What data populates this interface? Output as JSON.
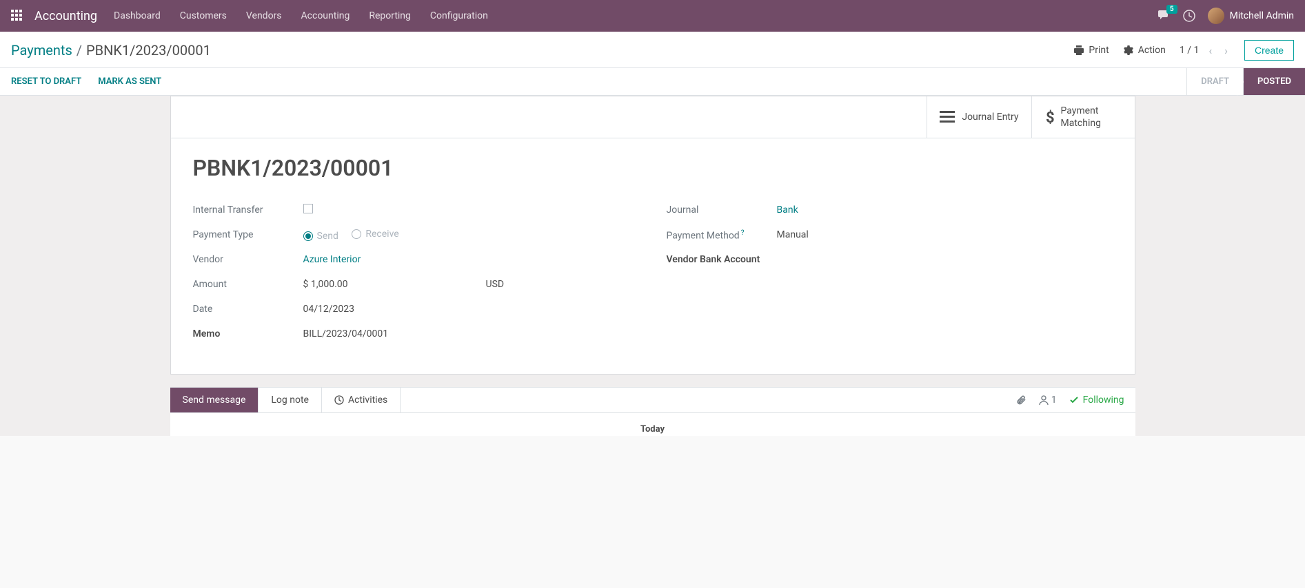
{
  "navbar": {
    "app_name": "Accounting",
    "menu": [
      "Dashboard",
      "Customers",
      "Vendors",
      "Accounting",
      "Reporting",
      "Configuration"
    ],
    "chat_badge": "5",
    "user_name": "Mitchell Admin"
  },
  "breadcrumb": {
    "parent": "Payments",
    "current": "PBNK1/2023/00001"
  },
  "toolbar": {
    "print": "Print",
    "action": "Action",
    "pager": "1 / 1",
    "create": "Create"
  },
  "status": {
    "reset": "RESET TO DRAFT",
    "mark_sent": "MARK AS SENT",
    "draft": "DRAFT",
    "posted": "POSTED"
  },
  "buttons": {
    "journal_entry": "Journal Entry",
    "payment_matching": "Payment\nMatching"
  },
  "record": {
    "title": "PBNK1/2023/00001",
    "labels": {
      "internal_transfer": "Internal Transfer",
      "payment_type": "Payment Type",
      "vendor": "Vendor",
      "amount": "Amount",
      "date": "Date",
      "memo": "Memo",
      "journal": "Journal",
      "payment_method": "Payment Method",
      "vendor_bank_account": "Vendor Bank Account"
    },
    "payment_type": {
      "send": "Send",
      "receive": "Receive"
    },
    "vendor": "Azure Interior",
    "amount": "$ 1,000.00",
    "currency": "USD",
    "date": "04/12/2023",
    "memo": "BILL/2023/04/0001",
    "journal": "Bank",
    "payment_method": "Manual"
  },
  "chatter": {
    "send_message": "Send message",
    "log_note": "Log note",
    "activities": "Activities",
    "followers_count": "1",
    "following": "Following",
    "today": "Today"
  }
}
